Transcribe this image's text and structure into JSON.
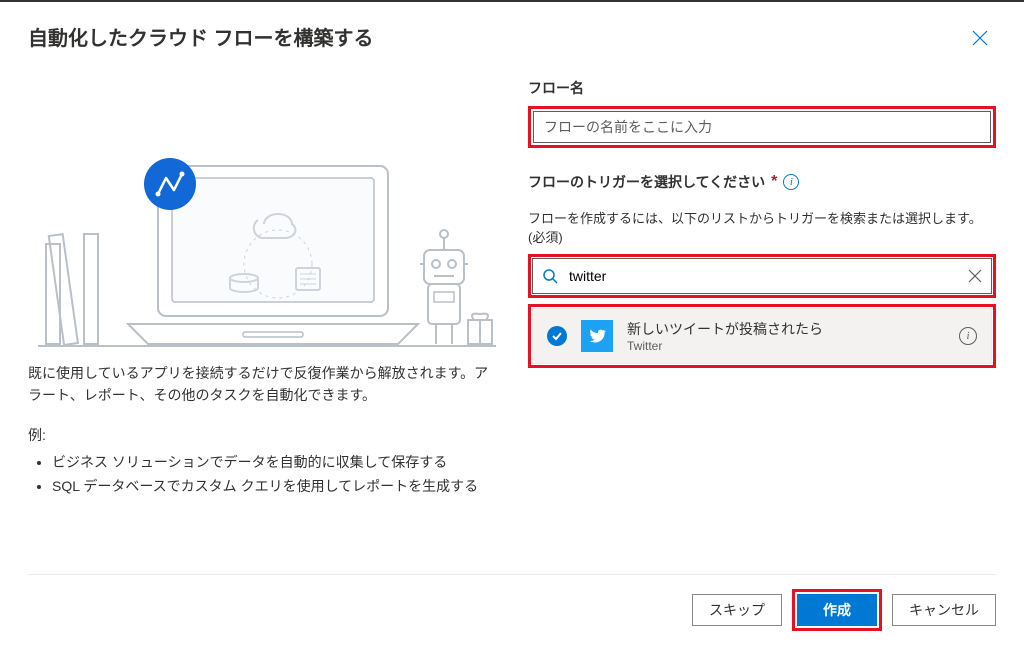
{
  "dialog": {
    "title": "自動化したクラウド フローを構築する",
    "description": "既に使用しているアプリを接続するだけで反復作業から解放されます。アラート、レポート、その他のタスクを自動化できます。",
    "examples_label": "例:",
    "examples": [
      "ビジネス ソリューションでデータを自動的に収集して保存する",
      "SQL データベースでカスタム クエリを使用してレポートを生成する"
    ]
  },
  "form": {
    "flow_name_label": "フロー名",
    "flow_name_placeholder": "フローの名前をここに入力",
    "flow_name_value": "",
    "trigger_label": "フローのトリガーを選択してください",
    "trigger_helper": "フローを作成するには、以下のリストからトリガーを検索または選択します。(必須)",
    "search_value": "twitter"
  },
  "triggers": [
    {
      "title": "新しいツイートが投稿されたら",
      "connector": "Twitter",
      "selected": true
    }
  ],
  "footer": {
    "skip": "スキップ",
    "create": "作成",
    "cancel": "キャンセル"
  }
}
